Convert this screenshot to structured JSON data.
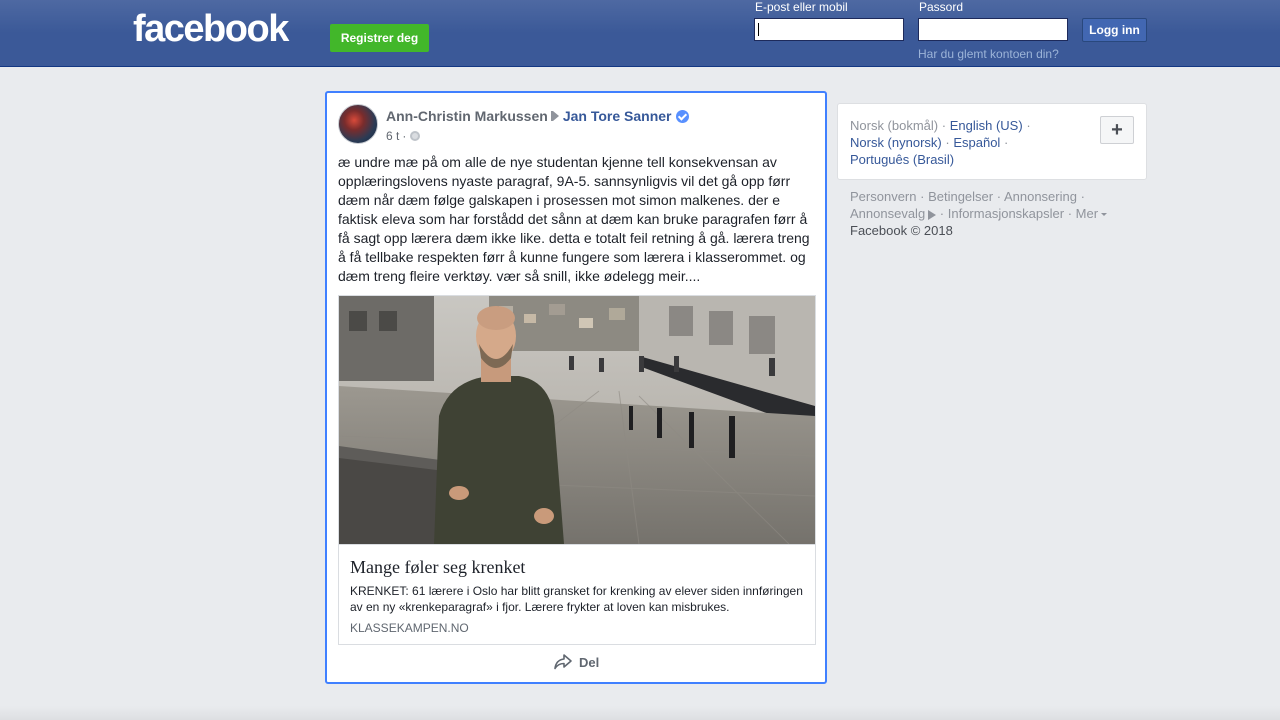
{
  "header": {
    "logo": "facebook",
    "register_label": "Registrer deg",
    "email_label": "E-post eller mobil",
    "email_value": "",
    "password_label": "Passord",
    "password_value": "",
    "login_label": "Logg inn",
    "forgot_label": "Har du glemt kontoen din?"
  },
  "post": {
    "author": "Ann-Christin Markussen",
    "target": "Jan Tore Sanner",
    "time": "6 t",
    "meta_separator": "·",
    "text": "æ undre mæ på om alle de nye studentan kjenne tell konsekvensan av opplæringslovens nyaste paragraf, 9A-5. sannsynligvis vil det gå opp førr dæm når dæm følge galskapen i prosessen mot simon malkenes. der e faktisk eleva som har forstådd det sånn at dæm kan bruke paragrafen førr å få sagt opp lærera dæm ikke like. detta e totalt feil retning å gå. lærera treng å få tellbake respekten førr å kunne fungere som lærera i klasserommet. og dæm treng fleire verktøy. vær så snill, ikke ødelegg meir....",
    "link": {
      "title": "Mange føler seg krenket",
      "description": "KRENKET: 61 lærere i Oslo har blitt gransket for krenking av elever siden innføringen av en ny «krenkeparagraf» i fjor. Lærere frykter at loven kan misbrukes.",
      "domain": "KLASSEKAMPEN.NO"
    },
    "share_label": "Del"
  },
  "languages": {
    "current": "Norsk (bokmål)",
    "options": [
      "English (US)",
      "Norsk (nynorsk)",
      "Español",
      "Português (Brasil)"
    ],
    "more_label": "+"
  },
  "footer": {
    "links": [
      "Personvern",
      "Betingelser",
      "Annonsering",
      "Annonsevalg",
      "Informasjonskapsler",
      "Mer"
    ],
    "copyright": "Facebook © 2018"
  },
  "colors": {
    "brand_blue": "#3b5998",
    "register_green": "#42b72a",
    "link_blue": "#365899",
    "focus_border": "#4080ff"
  }
}
